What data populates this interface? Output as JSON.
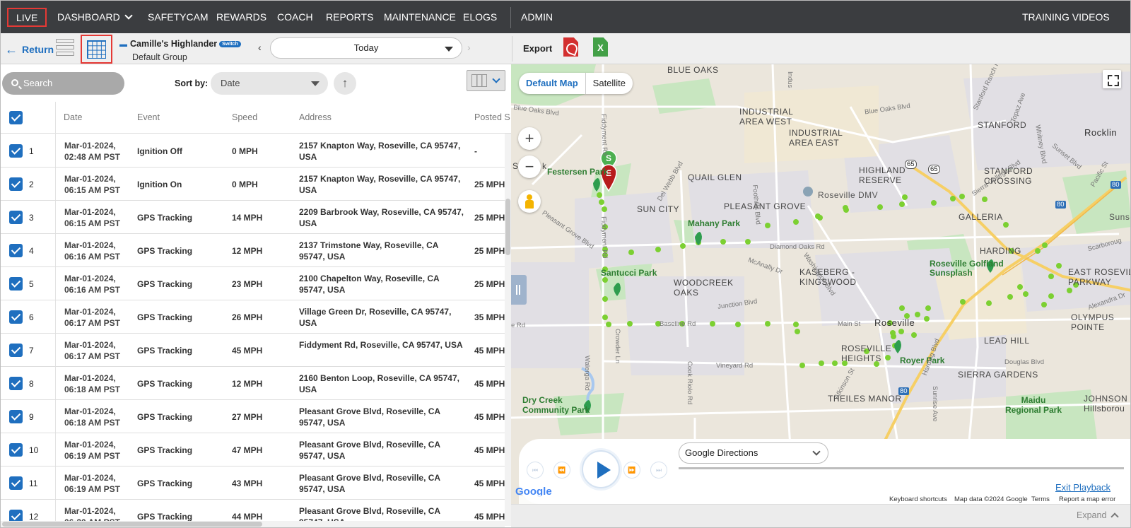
{
  "nav": {
    "live": "LIVE",
    "dashboard": "DASHBOARD",
    "safetycam": "SAFETYCAM",
    "rewards": "REWARDS",
    "coach": "COACH",
    "reports": "REPORTS",
    "maintenance": "MAINTENANCE",
    "elogs": "ELOGS",
    "admin": "ADMIN",
    "training": "TRAINING VIDEOS"
  },
  "toolbar": {
    "return": "Return",
    "vehicle_name": "Camille's Highlander",
    "switch": "Switch",
    "group": "Default Group",
    "day": "Today",
    "export": "Export",
    "xls_letter": "X"
  },
  "table": {
    "search_placeholder": "Search",
    "sort_label": "Sort by:",
    "sort_value": "Date",
    "columns": [
      "Date",
      "Event",
      "Speed",
      "Address",
      "Posted S"
    ],
    "rows": [
      {
        "num": "1",
        "date1": "Mar-01-2024,",
        "date2": "02:48 AM PST",
        "event": "Ignition Off",
        "speed": "0 MPH",
        "addr": "2157 Knapton Way, Roseville, CA 95747, USA",
        "posted": "-"
      },
      {
        "num": "2",
        "date1": "Mar-01-2024,",
        "date2": "06:15 AM PST",
        "event": "Ignition On",
        "speed": "0 MPH",
        "addr": "2157 Knapton Way, Roseville, CA 95747, USA",
        "posted": "25 MPH"
      },
      {
        "num": "3",
        "date1": "Mar-01-2024,",
        "date2": "06:15 AM PST",
        "event": "GPS Tracking",
        "speed": "14 MPH",
        "addr": "2209 Barbrook Way, Roseville, CA 95747, USA",
        "posted": "25 MPH"
      },
      {
        "num": "4",
        "date1": "Mar-01-2024,",
        "date2": "06:16 AM PST",
        "event": "GPS Tracking",
        "speed": "12 MPH",
        "addr": "2137 Trimstone Way, Roseville, CA 95747, USA",
        "posted": "25 MPH"
      },
      {
        "num": "5",
        "date1": "Mar-01-2024,",
        "date2": "06:16 AM PST",
        "event": "GPS Tracking",
        "speed": "23 MPH",
        "addr": "2100 Chapelton Way, Roseville, CA 95747, USA",
        "posted": "25 MPH"
      },
      {
        "num": "6",
        "date1": "Mar-01-2024,",
        "date2": "06:17 AM PST",
        "event": "GPS Tracking",
        "speed": "26 MPH",
        "addr": "Village Green Dr, Roseville, CA 95747, USA",
        "posted": "35 MPH"
      },
      {
        "num": "7",
        "date1": "Mar-01-2024,",
        "date2": "06:17 AM PST",
        "event": "GPS Tracking",
        "speed": "45 MPH",
        "addr": "Fiddyment Rd, Roseville, CA 95747, USA",
        "posted": "45 MPH"
      },
      {
        "num": "8",
        "date1": "Mar-01-2024,",
        "date2": "06:18 AM PST",
        "event": "GPS Tracking",
        "speed": "12 MPH",
        "addr": "2160 Benton Loop, Roseville, CA 95747, USA",
        "posted": "45 MPH"
      },
      {
        "num": "9",
        "date1": "Mar-01-2024,",
        "date2": "06:18 AM PST",
        "event": "GPS Tracking",
        "speed": "27 MPH",
        "addr": "Pleasant Grove Blvd, Roseville, CA 95747, USA",
        "posted": "45 MPH"
      },
      {
        "num": "10",
        "date1": "Mar-01-2024,",
        "date2": "06:19 AM PST",
        "event": "GPS Tracking",
        "speed": "47 MPH",
        "addr": "Pleasant Grove Blvd, Roseville, CA 95747, USA",
        "posted": "45 MPH"
      },
      {
        "num": "11",
        "date1": "Mar-01-2024,",
        "date2": "06:19 AM PST",
        "event": "GPS Tracking",
        "speed": "43 MPH",
        "addr": "Pleasant Grove Blvd, Roseville, CA 95747, USA",
        "posted": "45 MPH"
      },
      {
        "num": "12",
        "date1": "Mar-01-2024,",
        "date2": "06:20 AM PST",
        "event": "GPS Tracking",
        "speed": "44 MPH",
        "addr": "Pleasant Grove Blvd, Roseville, CA 95747, USA",
        "posted": "45 MPH"
      }
    ]
  },
  "map": {
    "default_map": "Default Map",
    "satellite": "Satellite",
    "start_marker": "S",
    "end_marker": "E",
    "labels": {
      "blue_oaks": "BLUE OAKS",
      "industrial_west": "INDUSTRIAL\nAREA WEST",
      "industrial_east": "INDUSTRIAL\nAREA EAST",
      "stanford": "STANFORD",
      "rocklin": "Rocklin",
      "festersen_park": "Festersen Park",
      "quail_glen": "QUAIL GLEN",
      "highland_reserve": "HIGHLAND\nRESERVE",
      "stanford_crossing": "STANFORD\nCROSSING",
      "roseville_dmv": "Roseville DMV",
      "sun_city": "SUN CITY",
      "pleasant_grove": "PLEASANT GROVE",
      "galleria": "GALLERIA",
      "sunset": "Sunset",
      "mahany_park": "Mahany Park",
      "harding": "HARDING",
      "santucci_park": "Santucci Park",
      "kaseberg": "KASEBERG -\nKINGSWOOD",
      "roseville_golfland": "Roseville Golfland\nSunsplash",
      "east_roseville": "EAST ROSEVILLE\nPARKWAY",
      "woodcreek": "WOODCREEK\nOAKS",
      "roseville": "Roseville",
      "olympus": "OLYMPUS\nPOINTE",
      "lead_hill": "LEAD HILL",
      "roseville_heights": "ROSEVILLE\nHEIGHTS",
      "royer_park": "Royer Park",
      "sierra_gardens": "SIERRA GARDENS",
      "dry_creek": "Dry Creek\nCommunity Park",
      "theiles_manor": "THEILES MANOR",
      "maidu": "Maidu\nRegional Park",
      "johnson": "JOHNSON RA\nHillsborou",
      "blue_oaks_blvd": "Blue Oaks Blvd",
      "diamond_oaks": "Diamond Oaks Rd",
      "baseline": "Baseline Rd",
      "junction": "Junction Blvd",
      "vineyard": "Vineyard Rd",
      "main_st": "Main St",
      "foothills": "Foothills Blvd",
      "washington": "Washington Blvd",
      "fiddyment": "Fiddyment Rd",
      "pleasant_grove_blvd": "Pleasant Grove Blvd",
      "crowder": "Crowder Ln",
      "walerga": "Walerga Rd",
      "cook_riolo": "Cook Riolo Rd",
      "atkinson": "Atkinson St",
      "harding_blvd": "Harding Blvd",
      "sunrise": "Sunrise Ave",
      "douglas": "Douglas Blvd",
      "stanford_ranch": "Stanford Ranch Rd",
      "topaz": "Topaz Ave",
      "whitney": "Whitney Blvd",
      "sunset_blvd": "Sunset Blvd",
      "pacific": "Pacific St",
      "sierra_college": "Sierra College Blvd",
      "scarborough": "Scarboroug",
      "alexandra": "Alexandra Dr",
      "del_webb": "Del Webb Blvd",
      "mcanally": "McAnally Dr",
      "mirror_s": "S",
      "mirror_k": "k",
      "mirror_e": "e Rd",
      "i80_1": "80",
      "i80_2": "80",
      "i80_3": "80",
      "hw65": "65",
      "hw65b": "65",
      "indus": "Indus"
    },
    "player": {
      "directions": "Google Directions",
      "exit": "Exit Playback"
    },
    "attribution": {
      "logo": "Google",
      "keyboard": "Keyboard shortcuts",
      "data": "Map data ©2024 Google",
      "terms": "Terms",
      "report": "Report a map error"
    },
    "expand": "Expand"
  }
}
